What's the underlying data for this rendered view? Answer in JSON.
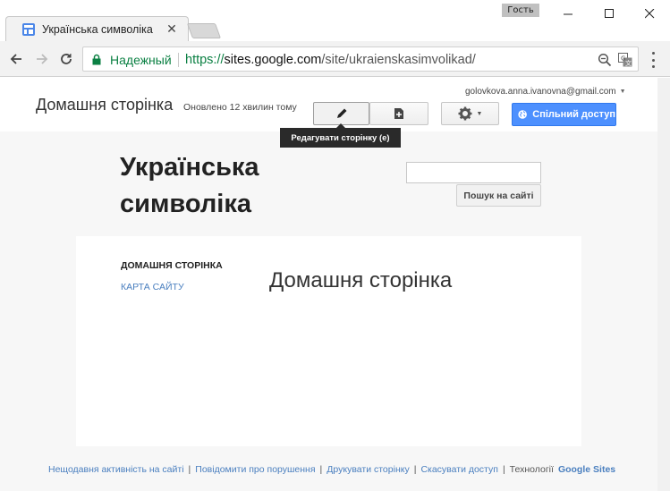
{
  "window": {
    "guest_label": "Гость",
    "tab_title": "Українська символіка"
  },
  "addressbar": {
    "secure_label": "Надежный",
    "url_scheme": "https://",
    "url_host": "sites.google.com",
    "url_path": "/site/ukraienskasimvolikad/"
  },
  "header": {
    "home_title": "Домашня сторінка",
    "updated": "Оновлено 12 хвилин тому",
    "account": "golovkova.anna.ivanovna@gmail.com",
    "share_label": "Спільний доступ",
    "edit_tooltip": "Редагувати сторінку (e)"
  },
  "site": {
    "name_line1": "Українська",
    "name_line2": "символіка",
    "search_value": "",
    "search_button": "Пошук на сайті"
  },
  "sidebar": {
    "items": [
      {
        "label": "ДОМАШНЯ СТОРІНКА"
      },
      {
        "label": "КАРТА САЙТУ"
      }
    ]
  },
  "main": {
    "heading": "Домашня сторінка"
  },
  "footer": {
    "links": [
      {
        "label": "Нещодавня активність на сайті"
      },
      {
        "label": "Повідомити про порушення"
      },
      {
        "label": "Друкувати сторінку"
      },
      {
        "label": "Скасувати доступ"
      }
    ],
    "powered_by": "Технології",
    "brand": "Google Sites"
  },
  "colors": {
    "accent_blue": "#4d90fe",
    "secure_green": "#0b8043",
    "link_blue": "#4a7fbf"
  }
}
